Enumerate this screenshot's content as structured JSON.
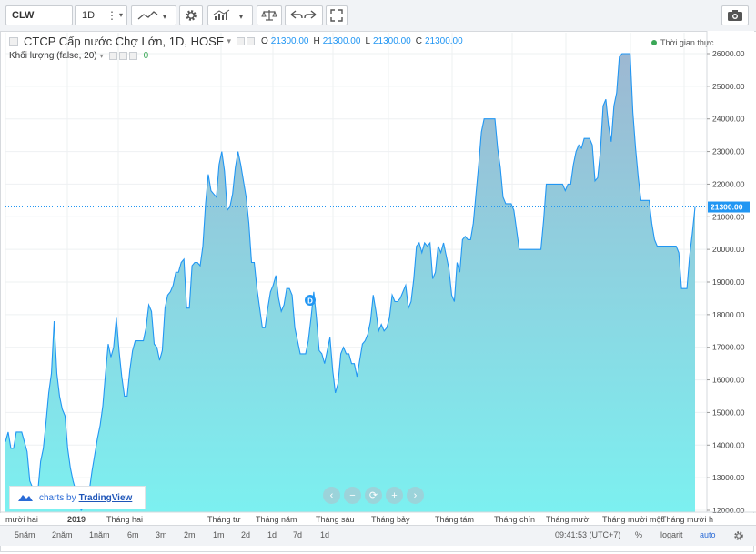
{
  "toolbar": {
    "symbol": "CLW",
    "interval": "1D",
    "dots": "⋮",
    "caret": "▾"
  },
  "legend": {
    "title": "CTCP Cấp nước Chợ Lớn, 1D, HOSE",
    "caret": "▾",
    "o_label": "O",
    "o_value": "21300.00",
    "h_label": "H",
    "h_value": "21300.00",
    "l_label": "L",
    "l_value": "21300.00",
    "c_label": "C",
    "c_value": "21300.00",
    "volume_label": "Khối lượng (false, 20)",
    "volume_value": "0",
    "realtime": "Thời gian thực"
  },
  "watermark": {
    "prefix": "charts by",
    "brand": "TradingView"
  },
  "nav_buttons": [
    "‹",
    "−",
    "⟳",
    "+",
    "›"
  ],
  "time_labels": [
    "mười hai",
    "2019",
    "Tháng hai",
    "Tháng tư",
    "Tháng năm",
    "Tháng sáu",
    "Tháng bảy",
    "Tháng tám",
    "Tháng chín",
    "Tháng mười",
    "Tháng mười một",
    "Tháng mười h"
  ],
  "ranges": [
    "5năm",
    "2năm",
    "1năm",
    "6m",
    "3m",
    "2m",
    "1m",
    "2d",
    "1d",
    "7d",
    "1d"
  ],
  "bottom": {
    "clock": "09:41:53 (UTC+7)",
    "percent": "%",
    "log": "logarit",
    "auto": "auto"
  },
  "colors": {
    "line": "#2196f3",
    "area_top": "#9db8d2",
    "area_bottom": "#7cf0f0",
    "volume": "#3fcf8e",
    "price_tag": "#2196f3"
  },
  "chart_data": {
    "type": "area",
    "title": "CTCP Cấp nước Chợ Lớn, 1D, HOSE",
    "ylim": [
      11800,
      26800
    ],
    "y_ticks": [
      12000,
      13000,
      14000,
      15000,
      16000,
      17000,
      18000,
      19000,
      20000,
      21000,
      22000,
      23000,
      24000,
      25000,
      26000
    ],
    "y_tick_labels": [
      "12000.00",
      "13000.00",
      "14000.00",
      "15000.00",
      "16000.00",
      "17000.00",
      "18000.00",
      "19000.00",
      "20000.00",
      "21000.00",
      "22000.00",
      "23000.00",
      "24000.00",
      "25000.00",
      "26000.00"
    ],
    "last_price": 21300,
    "last_price_label": "21300.00",
    "x_axis": "time (daily)",
    "grid": true,
    "series": [
      {
        "values": [
          14100,
          14400,
          13900,
          13900,
          14400,
          14400,
          14400,
          14100,
          13800,
          12900,
          12700,
          12400,
          12600,
          13500,
          13900,
          14700,
          15600,
          16200,
          17800,
          16200,
          15500,
          15100,
          14900,
          13900,
          13300,
          12900,
          12600,
          12200,
          12000,
          12100,
          12300,
          12600,
          13200,
          13700,
          14200,
          14600,
          15200,
          16200,
          17100,
          16700,
          17000,
          17900,
          16900,
          16100,
          15500,
          15500,
          16300,
          16900,
          17200,
          17200,
          17200,
          17200,
          17600,
          18300,
          18100,
          17100,
          17000,
          16600,
          16900,
          18200,
          18600,
          18700,
          18900,
          19300,
          19300,
          19600,
          19700,
          18200,
          18200,
          19500,
          19600,
          19600,
          19500,
          20100,
          21400,
          22300,
          21800,
          21700,
          21600,
          22600,
          23000,
          22400,
          21200,
          21300,
          21700,
          22500,
          23000,
          22600,
          22100,
          21600,
          20800,
          19600,
          19600,
          18800,
          18200,
          17600,
          17600,
          18200,
          18700,
          18900,
          19200,
          18500,
          18100,
          18300,
          18800,
          18800,
          18600,
          17600,
          17200,
          16800,
          16800,
          16800,
          17200,
          17900,
          18700,
          17900,
          16900,
          16800,
          16500,
          16900,
          17300,
          16300,
          15600,
          15900,
          16800,
          17000,
          16800,
          16800,
          16500,
          16500,
          16100,
          16600,
          17100,
          17200,
          17400,
          17800,
          18600,
          18100,
          17500,
          17700,
          17500,
          17600,
          17900,
          18600,
          18400,
          18400,
          18500,
          18700,
          18900,
          18200,
          18400,
          19100,
          20100,
          20200,
          19900,
          20200,
          20100,
          20200,
          19100,
          19300,
          20100,
          19900,
          20200,
          19800,
          19400,
          18600,
          18400,
          19600,
          19300,
          20300,
          20400,
          20300,
          20300,
          20800,
          21700,
          22600,
          23600,
          24000,
          24000,
          24000,
          24000,
          24000,
          23100,
          22500,
          21600,
          21400,
          21400,
          21400,
          21200,
          20600,
          20000,
          20000,
          20000,
          20000,
          20000,
          20000,
          20000,
          20000,
          20000,
          20900,
          22000,
          22000,
          22000,
          22000,
          22000,
          22000,
          22000,
          21800,
          22000,
          22000,
          22600,
          23000,
          23200,
          23100,
          23400,
          23400,
          23400,
          23200,
          22100,
          22200,
          23000,
          24400,
          24600,
          23800,
          23300,
          24400,
          24800,
          25900,
          26000,
          26000,
          26000,
          26000,
          24200,
          23100,
          22200,
          21500,
          21500,
          21500,
          21500,
          20800,
          20300,
          20100,
          20100,
          20100,
          20100,
          20100,
          20100,
          20100,
          20100,
          19900,
          18800,
          18800,
          18800,
          19800,
          20500,
          21300
        ]
      }
    ],
    "volume": {
      "ylim": [
        0,
        900000
      ],
      "values": [
        0,
        0,
        0,
        0,
        0,
        0,
        0,
        0,
        0,
        0,
        0,
        0,
        0,
        0,
        0,
        0,
        0,
        0,
        0,
        0,
        0,
        0,
        0,
        0,
        0,
        0,
        0,
        0,
        0,
        0,
        0,
        0,
        0,
        0,
        0,
        0,
        0,
        0,
        0,
        0,
        0,
        0,
        0,
        0,
        0,
        0,
        0,
        0,
        0,
        0,
        0,
        0,
        0,
        0,
        0,
        0,
        0,
        0,
        0,
        0,
        0,
        0,
        0,
        0,
        0,
        0,
        0,
        0,
        0,
        0,
        0,
        0,
        0,
        0,
        0,
        0,
        0,
        0,
        0,
        0,
        0,
        0,
        0,
        0,
        0,
        0,
        0,
        0,
        0,
        0,
        0,
        0,
        0,
        0,
        0,
        0,
        0,
        0,
        0,
        0,
        0,
        0,
        0,
        0,
        0,
        0,
        0,
        0,
        0,
        0,
        0,
        0,
        0,
        0,
        0,
        0,
        0,
        0,
        0,
        0,
        0,
        0,
        0,
        0,
        0,
        0,
        0,
        0,
        0,
        0,
        0,
        0,
        0,
        0,
        0,
        0,
        0,
        0,
        0,
        0,
        0,
        0,
        0,
        0,
        0,
        0,
        0,
        0,
        0,
        0,
        0,
        0,
        0,
        0,
        0,
        0,
        0,
        0,
        0,
        0,
        0,
        0,
        0,
        0,
        0,
        0,
        0,
        0,
        0,
        0,
        0,
        0,
        0,
        0,
        0,
        0,
        0,
        0,
        0,
        0,
        0,
        0,
        0,
        0,
        0,
        0,
        0,
        0,
        0,
        0,
        0,
        0,
        0,
        0,
        0,
        0,
        0,
        0,
        0,
        0,
        0,
        0,
        0,
        0,
        0,
        0,
        0,
        0,
        0,
        0,
        0,
        0,
        0,
        0,
        0,
        0,
        0,
        0,
        0,
        0,
        0,
        0,
        0,
        0,
        0,
        0,
        0,
        0,
        0,
        0,
        0,
        0,
        0,
        0,
        0,
        0,
        0,
        0,
        0,
        0,
        0,
        0,
        0,
        0,
        0,
        0,
        0,
        0,
        0,
        0,
        0,
        0,
        0,
        0,
        0,
        0,
        0,
        0,
        0,
        0,
        0,
        0,
        0,
        0,
        0,
        0,
        0,
        0,
        0,
        0,
        0,
        0,
        0,
        0,
        0,
        0,
        0,
        0,
        0
      ]
    }
  }
}
